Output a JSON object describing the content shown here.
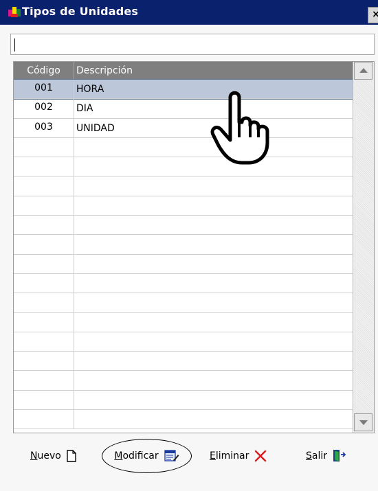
{
  "window": {
    "title": "Tipos de Unidades",
    "close_label": "×"
  },
  "search": {
    "value": ""
  },
  "grid": {
    "columns": [
      "Código",
      "Descripción"
    ],
    "rows": [
      {
        "code": "001",
        "description": "HORA"
      },
      {
        "code": "002",
        "description": "DIA"
      },
      {
        "code": "003",
        "description": "UNIDAD"
      }
    ]
  },
  "toolbar": {
    "new_first": "N",
    "new_rest": "uevo",
    "modify_first": "M",
    "modify_rest": "odificar",
    "delete_first": "E",
    "delete_rest": "liminar",
    "exit_first": "S",
    "exit_rest": "alir"
  },
  "colors": {
    "titlebar": "#0a226e",
    "header": "#7f7f7f",
    "selected_row": "#bcc7d9"
  }
}
